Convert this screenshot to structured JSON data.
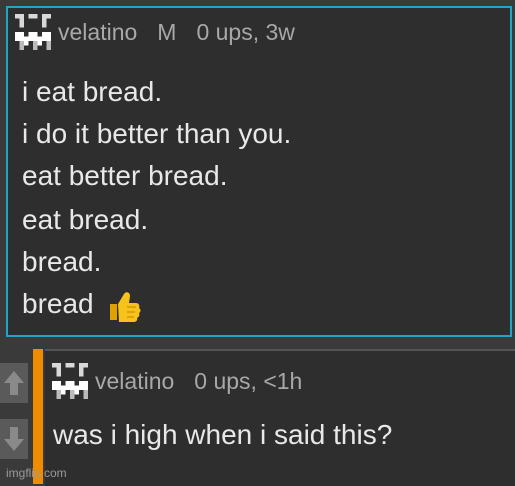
{
  "comment": {
    "username": "velatino",
    "gender": "M",
    "meta": "0 ups, 3w",
    "lines": [
      "i eat bread.",
      "i do it better than you.",
      "eat better bread.",
      "eat bread.",
      "bread.",
      "bread"
    ],
    "emoji": "thumbs-up",
    "border_color": "#1fa5c9"
  },
  "reply": {
    "username": "velatino",
    "meta": "0 ups, <1h",
    "text": "was i high when i said this?",
    "bar_color": "#f08c00"
  },
  "watermark": "imgflip.com"
}
